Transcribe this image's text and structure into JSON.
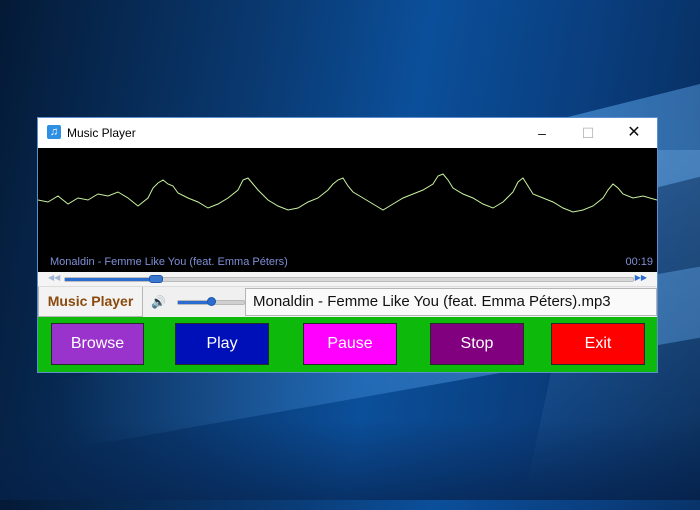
{
  "window": {
    "title": "Music Player",
    "icon": "music-note-icon"
  },
  "visualizer": {
    "track_name": "Monaldin - Femme Like You (feat. Emma Péters)",
    "elapsed": "00:19",
    "wave_color": "#c8f2a0"
  },
  "seek": {
    "progress": 0.16
  },
  "controls": {
    "brand_label": "Music Player",
    "volume_level": 0.5,
    "filename": "Monaldin - Femme Like You (feat. Emma Péters).mp3"
  },
  "buttons": [
    {
      "label": "Browse",
      "color": "#9933cc"
    },
    {
      "label": "Play",
      "color": "#0010b8"
    },
    {
      "label": "Pause",
      "color": "#ff00ff"
    },
    {
      "label": "Stop",
      "color": "#800080"
    },
    {
      "label": "Exit",
      "color": "#ff0000"
    }
  ],
  "colors": {
    "button_bar": "#0db90a",
    "brand_text": "#8a4a0d",
    "accent": "#2a6cd0"
  }
}
